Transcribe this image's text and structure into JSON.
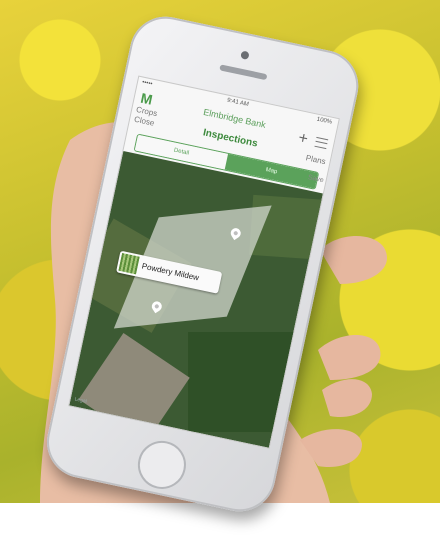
{
  "app": {
    "status": {
      "signal": "•••••",
      "time": "9:41 AM",
      "battery": "100%"
    },
    "nav": {
      "logo": "M",
      "farm_name": "Elmbridge Bank",
      "left_link": "Crops",
      "add_icon": "plus-icon",
      "menu_icon": "menu-icon"
    },
    "subnav": {
      "close": "Close",
      "title": "Inspections",
      "right_link": "Plans"
    },
    "segment": {
      "detail_label": "Detail",
      "map_label": "Map",
      "selected": "Map"
    },
    "save_label": "Save",
    "map": {
      "callout_label": "Powdery Mildew",
      "legal": "Legal"
    }
  },
  "colors": {
    "accent": "#5ba25b",
    "rapeseed": "#e3d43a"
  }
}
